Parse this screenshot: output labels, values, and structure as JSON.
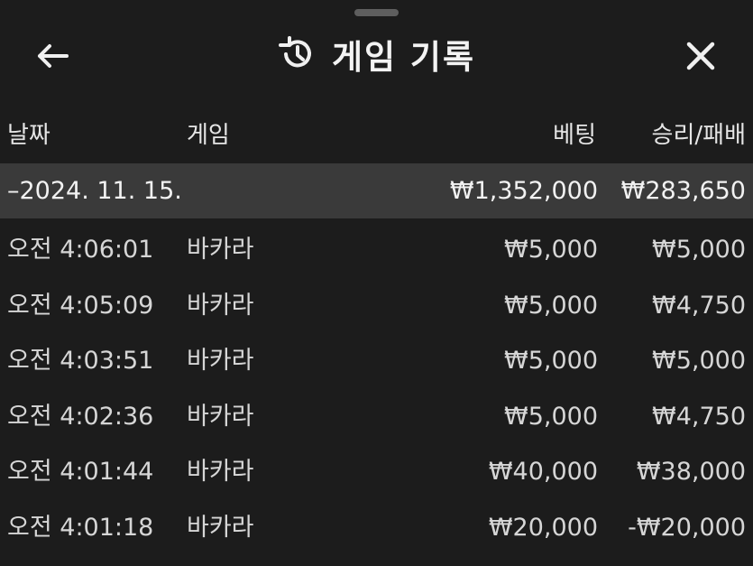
{
  "header": {
    "title": "게임 기록",
    "back_icon": "arrow-left-icon",
    "history_icon": "history-icon",
    "close_icon": "close-icon"
  },
  "columns": {
    "date": "날짜",
    "game": "게임",
    "bet": "베팅",
    "result": "승리/패배"
  },
  "summary": {
    "date": "–2024. 11. 15.",
    "bet": "₩1,352,000",
    "result": "₩283,650"
  },
  "rows": [
    {
      "time": "오전 4:06:01",
      "game": "바카라",
      "bet": "₩5,000",
      "result": "₩5,000"
    },
    {
      "time": "오전 4:05:09",
      "game": "바카라",
      "bet": "₩5,000",
      "result": "₩4,750"
    },
    {
      "time": "오전 4:03:51",
      "game": "바카라",
      "bet": "₩5,000",
      "result": "₩5,000"
    },
    {
      "time": "오전 4:02:36",
      "game": "바카라",
      "bet": "₩5,000",
      "result": "₩4,750"
    },
    {
      "time": "오전 4:01:44",
      "game": "바카라",
      "bet": "₩40,000",
      "result": "₩38,000"
    },
    {
      "time": "오전 4:01:18",
      "game": "바카라",
      "bet": "₩20,000",
      "result": "-₩20,000"
    }
  ],
  "colors": {
    "background": "#1c1c1c",
    "summary_row": "#3a3a3a",
    "text": "#d6d6d6",
    "handle": "#5e5e5e"
  }
}
